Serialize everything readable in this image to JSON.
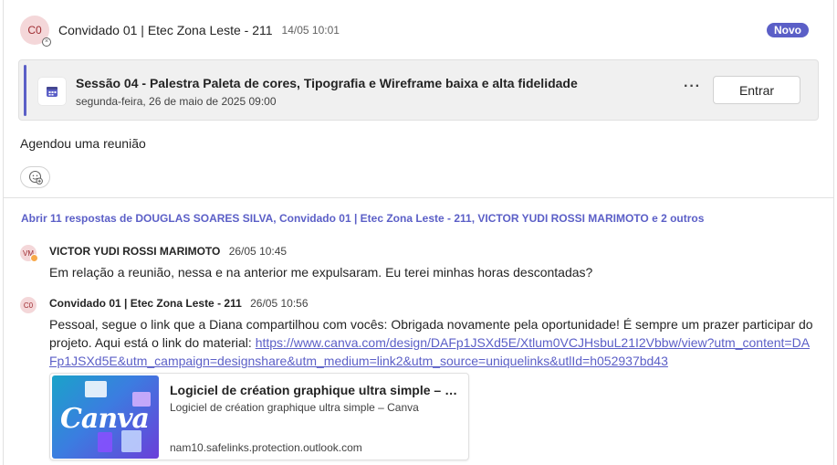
{
  "post": {
    "avatar_initials": "C0",
    "author": "Convidado 01 | Etec Zona Leste - 211",
    "time": "14/05 10:01",
    "badge": "Novo",
    "body": "Agendou uma reunião"
  },
  "meeting": {
    "title": "Sessão 04 - Palestra Paleta de cores, Tipografia e Wireframe baixa e alta fidelidade",
    "date": "segunda-feira, 26 de maio de 2025 09:00",
    "more_label": "···",
    "join_label": "Entrar"
  },
  "replies_link": "Abrir 11 respostas de DOUGLAS SOARES SILVA, Convidado 01 | Etec Zona Leste - 211, VICTOR YUDI ROSSI MARIMOTO e 2 outros",
  "replies": [
    {
      "avatar_initials": "VM",
      "author": "VICTOR YUDI ROSSI MARIMOTO",
      "time": "26/05 10:45",
      "text": "Em relação a reunião, nessa e na anterior me expulsaram. Eu terei minhas horas descontadas?"
    },
    {
      "avatar_initials": "C0",
      "author": "Convidado 01 | Etec Zona Leste - 211",
      "time": "26/05 10:56",
      "text": "Pessoal, segue o link que a Diana compartilhou com vocês: Obrigada novamente pela oportunidade! É sempre um prazer participar do projeto. Aqui está o link do material: ",
      "link": "https://www.canva.com/design/DAFp1JSXd5E/Xtlum0VCJHsbuL21I2Vbbw/view?utm_content=DAFp1JSXd5E&utm_campaign=designshare&utm_medium=link2&utm_source=uniquelinks&utlId=h052937bd43"
    }
  ],
  "preview": {
    "logo_text": "Canva",
    "title": "Logiciel de création graphique ultra simple – Ca...",
    "description": "Logiciel de création graphique ultra simple – Canva",
    "domain": "nam10.safelinks.protection.outlook.com"
  },
  "colors": {
    "accent": "#5b5fc7",
    "avatar_bg": "#f4d7d9",
    "presence_away": "#f8a94a"
  }
}
